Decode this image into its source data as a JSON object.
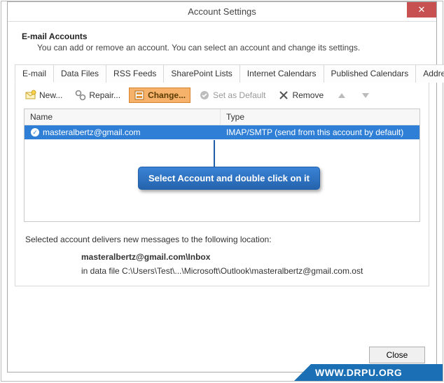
{
  "window": {
    "title": "Account Settings",
    "close_symbol": "✕"
  },
  "header": {
    "title": "E-mail Accounts",
    "description": "You can add or remove an account. You can select an account and change its settings."
  },
  "tabs": [
    {
      "label": "E-mail",
      "active": true
    },
    {
      "label": "Data Files"
    },
    {
      "label": "RSS Feeds"
    },
    {
      "label": "SharePoint Lists"
    },
    {
      "label": "Internet Calendars"
    },
    {
      "label": "Published Calendars"
    },
    {
      "label": "Address Books"
    }
  ],
  "toolbar": {
    "new_label": "New...",
    "repair_label": "Repair...",
    "change_label": "Change...",
    "default_label": "Set as Default",
    "remove_label": "Remove"
  },
  "list": {
    "columns": {
      "name": "Name",
      "type": "Type"
    },
    "rows": [
      {
        "name": "masteralbertz@gmail.com",
        "type": "IMAP/SMTP (send from this account by default)",
        "selected": true
      }
    ]
  },
  "callout": "Select Account and double click on it",
  "delivery": {
    "intro": "Selected account delivers new messages to the following location:",
    "location_main": "masteralbertz@gmail.com\\Inbox",
    "location_detail": "in data file C:\\Users\\Test\\...\\Microsoft\\Outlook\\masteralbertz@gmail.com.ost"
  },
  "footer": {
    "close_label": "Close"
  },
  "watermark": "WWW.DRPU.ORG"
}
